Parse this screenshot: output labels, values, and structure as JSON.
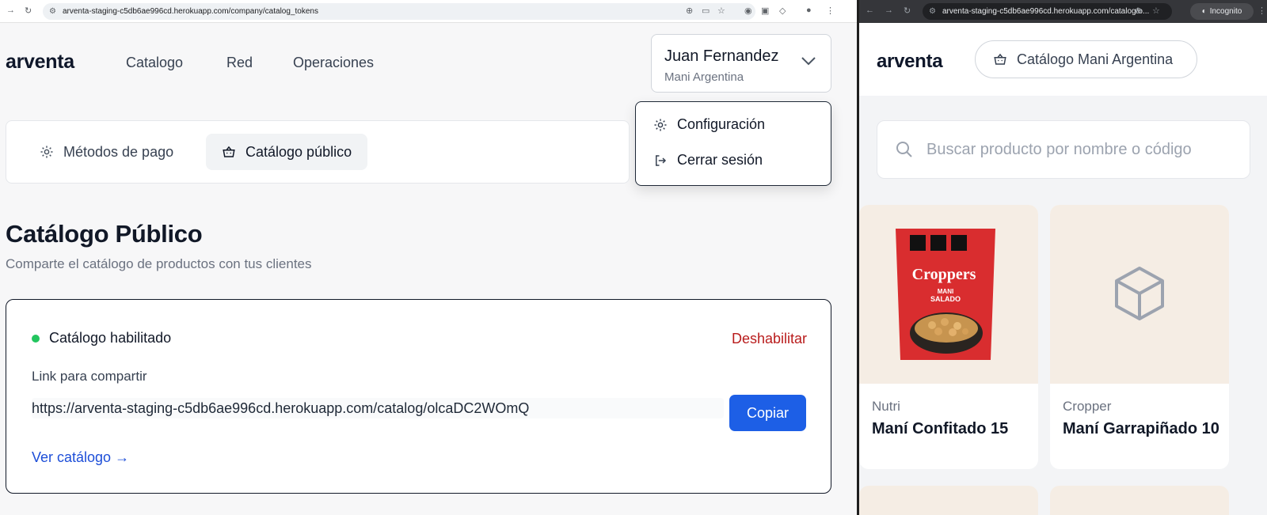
{
  "left_browser": {
    "url": "arventa-staging-c5db6ae996cd.herokuapp.com/company/catalog_tokens"
  },
  "right_browser": {
    "url": "arventa-staging-c5db6ae996cd.herokuapp.com/catalog/o...",
    "incognito_label": "Incognito"
  },
  "app": {
    "brand": "arventa",
    "nav": [
      "Catalogo",
      "Red",
      "Operaciones"
    ],
    "user": {
      "name": "Juan Fernandez",
      "company": "Mani Argentina"
    },
    "menu": {
      "settings": "Configuración",
      "logout": "Cerrar sesión"
    },
    "subnav": {
      "payments": "Métodos de pago",
      "catalog": "Catálogo público"
    },
    "page_title": "Catálogo Público",
    "page_subtitle": "Comparte el catálogo de productos con tus clientes",
    "card": {
      "status": "Catálogo habilitado",
      "disable": "Deshabilitar",
      "link_label": "Link para compartir",
      "link": "https://arventa-staging-c5db6ae996cd.herokuapp.com/catalog/olcaDC2WOmQ",
      "copy": "Copiar",
      "view": "Ver catálogo →"
    }
  },
  "catalog": {
    "brand": "arventa",
    "catalog_button": "Catálogo Mani Argentina",
    "search_placeholder": "Buscar producto por nombre o código",
    "products": [
      {
        "brand": "Nutri",
        "name": "Maní Confitado 15",
        "package_brand": "Croppers",
        "package_line1": "MANI",
        "package_line2": "SALADO"
      },
      {
        "brand": "Cropper",
        "name": "Maní Garrapiñado 10"
      }
    ]
  },
  "colors": {
    "accent": "#1d5fe6",
    "danger": "#b91c1c",
    "enabled": "#22c55e",
    "product_bg": "#f5ede4"
  }
}
